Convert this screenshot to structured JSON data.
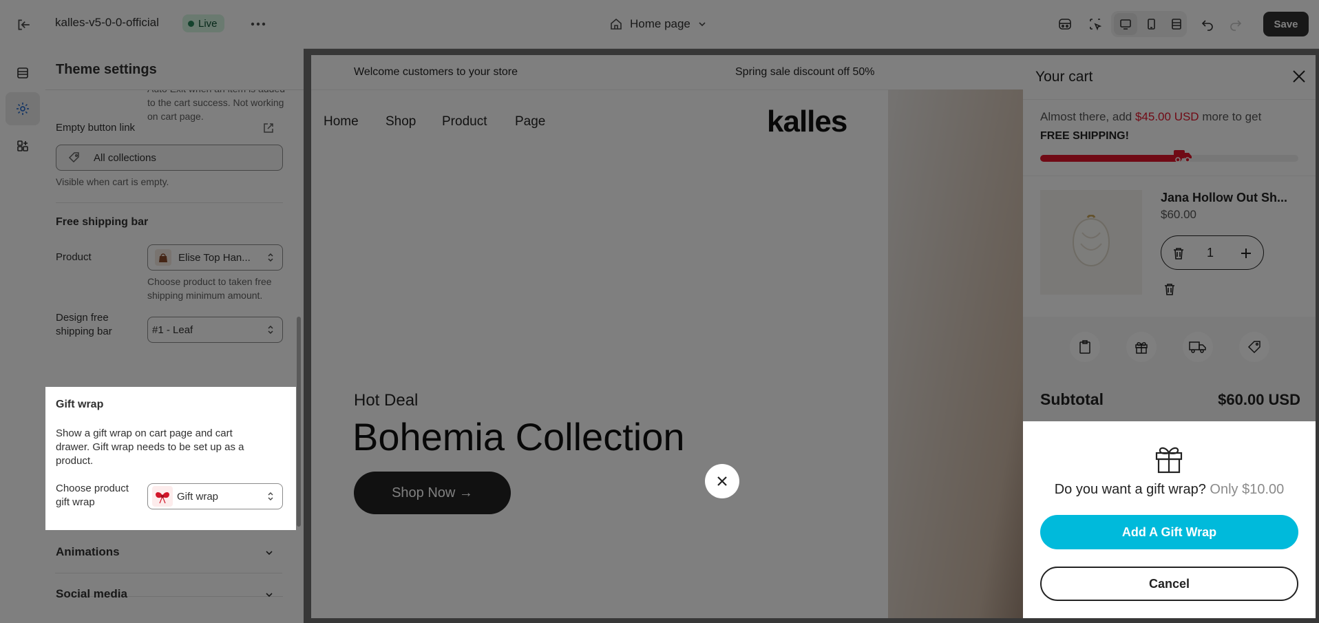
{
  "topbar": {
    "store_name": "kalles-v5-0-0-official",
    "live_badge": "Live",
    "page_selector": "Home page",
    "save_label": "Save"
  },
  "sidebar_panel": {
    "title": "Theme settings",
    "partial_text": "Auto Exit when an item is added to the cart success. Not working on cart page.",
    "empty_button_link": {
      "label": "Empty button link",
      "value": "All collections",
      "hint": "Visible when cart is empty."
    },
    "free_shipping_bar": {
      "heading": "Free shipping bar",
      "product_label": "Product",
      "product_value": "Elise Top Han...",
      "product_hint": "Choose product to taken free shipping minimum amount.",
      "design_label": "Design free shipping bar",
      "design_value": "#1 - Leaf"
    },
    "gift_wrap": {
      "heading": "Gift wrap",
      "description": "Show a gift wrap on cart page and cart drawer. Gift wrap needs to be set up as a product.",
      "choose_label": "Choose product gift wrap",
      "choose_value": "Gift wrap"
    },
    "animations": "Animations",
    "social_media": "Social media"
  },
  "preview": {
    "announcement_left": "Welcome customers to your store",
    "announcement_right": "Spring sale discount off 50%",
    "nav": [
      "Home",
      "Shop",
      "Product",
      "Page"
    ],
    "logo": "kalles",
    "hero_kicker": "Hot Deal",
    "hero_title": "Bohemia Collection",
    "hero_button": "Shop Now →"
  },
  "cart": {
    "title": "Your cart",
    "shipping_msg_pre": "Almost there, add ",
    "shipping_amount": "$45.00 USD",
    "shipping_msg_post": " more to get",
    "shipping_free": "FREE SHIPPING!",
    "progress_fraction": 0.55,
    "item_name": "Jana Hollow Out Sh...",
    "item_price": "$60.00",
    "quantity": "1",
    "subtotal_label": "Subtotal",
    "subtotal_value": "$60.00 USD"
  },
  "gift_popup": {
    "question": "Do you want a gift wrap?",
    "price": "Only $10.00",
    "add_button": "Add A Gift Wrap",
    "cancel_button": "Cancel"
  },
  "colors": {
    "accent": "#00badb",
    "sale_red": "#e0142a",
    "live_green": "#29845a"
  }
}
